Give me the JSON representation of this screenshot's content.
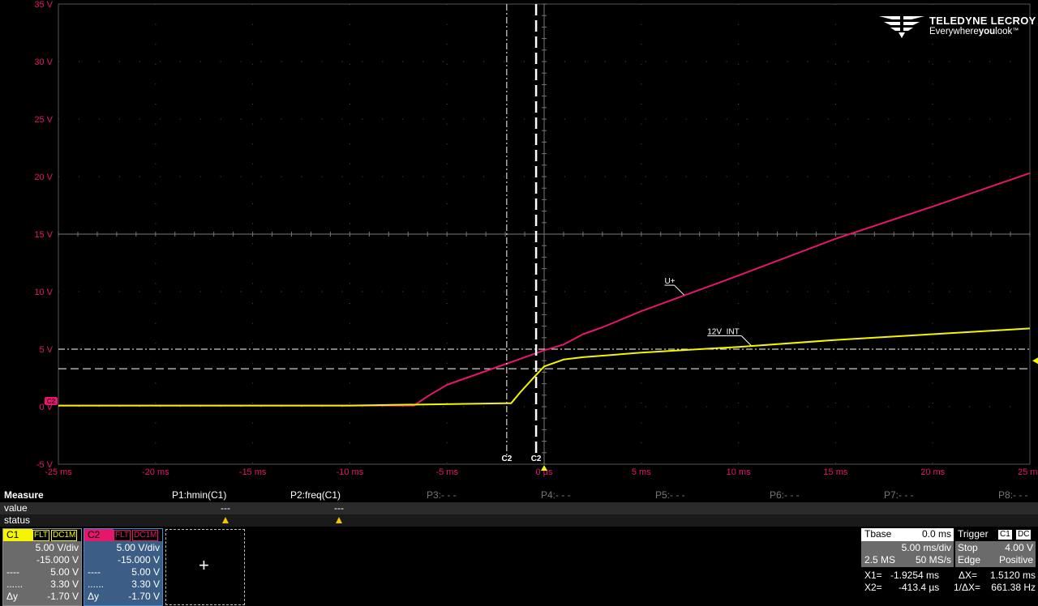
{
  "brand": {
    "name": "TELEDYNE LECROY",
    "tagline_pre": "Everywhere",
    "tagline_bold": "you",
    "tagline_post": "look",
    "trademark": "™"
  },
  "colors": {
    "background": "#000000",
    "grid": "#555555",
    "c1": "#f5f500",
    "c2": "#e5176b",
    "label_magenta": "#e5176b",
    "cursor": "#ffffff"
  },
  "chart_data": {
    "type": "line",
    "xlim": [
      -25,
      25
    ],
    "ylim": [
      -5,
      35
    ],
    "xunit": "ms",
    "yunit": "V",
    "x_ticks": [
      "-25 ms",
      "-20 ms",
      "-15 ms",
      "-10 ms",
      "-5 ms",
      "0 µs",
      "5 ms",
      "10 ms",
      "15 ms",
      "20 ms",
      "25 ms"
    ],
    "y_ticks": [
      "-5 V",
      "0 V",
      "5 V",
      "10 V",
      "15 V",
      "20 V",
      "25 V",
      "30 V",
      "35 V"
    ],
    "grid": true,
    "series": [
      {
        "name": "U+",
        "channel": "C2",
        "color": "#e5176b",
        "x": [
          -25,
          -6.7,
          -6,
          -5,
          -2,
          0,
          1,
          2,
          3,
          5,
          10,
          15,
          20,
          25
        ],
        "y": [
          0.1,
          0.1,
          0.9,
          1.9,
          3.7,
          4.9,
          5.4,
          6.3,
          6.9,
          8.3,
          11.4,
          14.6,
          17.4,
          20.3
        ]
      },
      {
        "name": "12V_INT",
        "channel": "C1",
        "color": "#f5f500",
        "x": [
          -25,
          -10,
          -2,
          -1.7,
          -1.2,
          -0.5,
          0,
          1,
          2,
          5,
          10,
          15,
          20,
          25
        ],
        "y": [
          0.1,
          0.1,
          0.3,
          0.3,
          1.3,
          2.6,
          3.5,
          4.1,
          4.3,
          4.7,
          5.2,
          5.8,
          6.3,
          6.8
        ]
      }
    ],
    "annotations": [
      {
        "text": "U+",
        "x": 6.2,
        "y": 10.7
      },
      {
        "text": "12V_INT",
        "x": 8.4,
        "y": 6.3
      }
    ],
    "cursors": {
      "vertical": [
        {
          "label": "C2",
          "x": -1.9254,
          "style": "dash-dot"
        },
        {
          "label": "C2",
          "x": -0.4134,
          "style": "dashed"
        }
      ],
      "horizontal": [
        {
          "y": 5.0,
          "style": "dash-dot"
        },
        {
          "y": 3.3,
          "style": "dashed"
        }
      ]
    },
    "ground_marker": "C2",
    "trigger_level_marker": 4.0
  },
  "measure": {
    "title": "Measure",
    "row_labels": [
      "value",
      "status"
    ],
    "params": [
      {
        "label": "P1:hmin(C1)",
        "value": "---",
        "warn": true
      },
      {
        "label": "P2:freq(C1)",
        "value": "---",
        "warn": true
      },
      {
        "label": "P3:- - -",
        "value": "",
        "warn": false
      },
      {
        "label": "P4:- - -",
        "value": "",
        "warn": false
      },
      {
        "label": "P5:- - -",
        "value": "",
        "warn": false
      },
      {
        "label": "P6:- - -",
        "value": "",
        "warn": false
      },
      {
        "label": "P7:- - -",
        "value": "",
        "warn": false
      },
      {
        "label": "P8:- - -",
        "value": "",
        "warn": false
      }
    ]
  },
  "channels": {
    "c1": {
      "name": "C1",
      "tag1": "FLT",
      "tag2": "DC1M",
      "vdiv": "5.00 V/div",
      "offset": "-15.000 V",
      "cur1_label": "----",
      "cur1": "5.00 V",
      "cur2_label": "......",
      "cur2": "3.30 V",
      "dy_label": "Δy",
      "dy": "-1.70 V"
    },
    "c2": {
      "name": "C2",
      "tag1": "FLT",
      "tag2": "DC1M",
      "vdiv": "5.00 V/div",
      "offset": "-15.000 V",
      "cur1_label": "----",
      "cur1": "5.00 V",
      "cur2_label": "......",
      "cur2": "3.30 V",
      "dy_label": "Δy",
      "dy": "-1.70 V"
    }
  },
  "new_trace": {
    "plus": "+"
  },
  "timebase": {
    "title": "Tbase",
    "delay": "0.0 ms",
    "tdiv": "5.00 ms/div",
    "samples": "2.5 MS",
    "rate": "50 MS/s"
  },
  "trigger": {
    "title": "Trigger",
    "chip1": "C1",
    "chip2": "DC",
    "mode": "Stop",
    "level": "4.00 V",
    "type": "Edge",
    "slope": "Positive"
  },
  "cursor_readout": {
    "x1_label": "X1=",
    "x1": "-1.9254 ms",
    "dx_label": "ΔX=",
    "dx": "1.5120 ms",
    "x2_label": "X2=",
    "x2": "-413.4 µs",
    "inv_label": "1/ΔX=",
    "inv": "661.38 Hz"
  }
}
